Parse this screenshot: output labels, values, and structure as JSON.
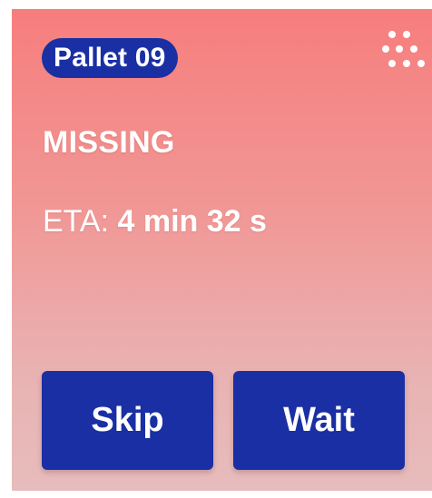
{
  "card": {
    "pallet_label": "Pallet 09",
    "status": "MISSING",
    "eta_label": "ETA:",
    "eta_value": "4 min 32 s",
    "menu_icon": "dots-grid-icon"
  },
  "actions": {
    "skip_label": "Skip",
    "wait_label": "Wait"
  },
  "colors": {
    "accent": "#1a2fa3",
    "card_top": "#f67e7d",
    "card_bottom": "#e7bcbc",
    "text": "#ffffff"
  }
}
